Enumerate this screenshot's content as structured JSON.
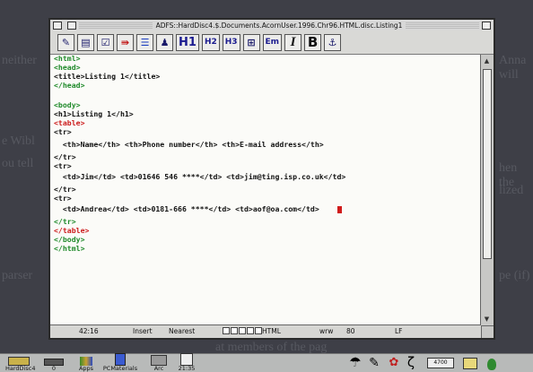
{
  "background_text": [
    "neither",
    "at members of the pag",
    "e will other HTML tags as for",
    "comments.",
    "e Wibl",
    "ou tell",
    "Anna will",
    "hen the",
    "lized",
    "Third, the parser is tion...",
    "parser",
    "pe (if)"
  ],
  "window": {
    "title": "ADFS::HardDisc4.$.Documents.AcornUser.1996.Chr96.HTML.disc.Listing1"
  },
  "toolbar": {
    "tools": [
      {
        "name": "pencil-icon",
        "label": "✎"
      },
      {
        "name": "list-icon",
        "label": "▤"
      },
      {
        "name": "check-icon",
        "label": "☑"
      },
      {
        "name": "arrow-right-icon",
        "label": "⇛"
      },
      {
        "name": "rule-icon",
        "label": "☰"
      },
      {
        "name": "image-icon",
        "label": "♟"
      },
      {
        "name": "h1-button",
        "label": "H1"
      },
      {
        "name": "h2-button",
        "label": "H2"
      },
      {
        "name": "h3-button",
        "label": "H3"
      },
      {
        "name": "blockquote-button",
        "label": "⊞"
      },
      {
        "name": "em-button",
        "label": "Em"
      },
      {
        "name": "italic-button",
        "label": "I"
      },
      {
        "name": "bold-button",
        "label": "B"
      },
      {
        "name": "anchor-icon",
        "label": "⚓"
      }
    ]
  },
  "editor": {
    "lines": [
      {
        "text": "<html>",
        "color": "green"
      },
      {
        "text": "<head>",
        "color": "green"
      },
      {
        "text": "<title>Listing 1</title>",
        "color": "black"
      },
      {
        "text": "</head>",
        "color": "green"
      },
      {
        "text": "",
        "color": "black"
      },
      {
        "text": "<body>",
        "color": "green"
      },
      {
        "text": "<h1>Listing 1</h1>",
        "color": "black"
      },
      {
        "text": "<table>",
        "color": "red"
      },
      {
        "text": "<tr>",
        "color": "black"
      },
      {
        "text": "  <th>Name</th> <th>Phone number</th> <th>E-mail address</th>",
        "color": "black"
      },
      {
        "text": "</tr>",
        "color": "black"
      },
      {
        "text": "<tr>",
        "color": "black"
      },
      {
        "text": "  <td>Jim</td> <td>01646 546 ****</td> <td>jim@ting.isp.co.uk</td>",
        "color": "black"
      },
      {
        "text": "</tr>",
        "color": "black"
      },
      {
        "text": "<tr>",
        "color": "black"
      },
      {
        "text": "  <td>Andrea</td> <td>0181-666 ****</td> <td>aof@oa.com</td>",
        "color": "black"
      },
      {
        "text": "</tr>",
        "color": "green"
      },
      {
        "text": "</table>",
        "color": "red"
      },
      {
        "text": "</body>",
        "color": "green"
      },
      {
        "text": "</html>",
        "color": "green"
      }
    ]
  },
  "statusbar": {
    "position": "42:16",
    "mode": "Insert",
    "match": "Nearest",
    "type": "HTML",
    "wrap": "wrw",
    "width": "80",
    "eol": "LF"
  },
  "iconbar": {
    "items": [
      {
        "name": "harddisc-icon",
        "label": "HardDisc4"
      },
      {
        "name": "floppy-icon",
        "label": "0"
      },
      {
        "name": "apps-icon",
        "label": "Apps"
      },
      {
        "name": "pcmaterials-icon",
        "label": "PCMaterials"
      },
      {
        "name": "arcfs-icon",
        "label": "Arc"
      },
      {
        "name": "clock-icon",
        "label": "21:35"
      },
      {
        "name": "tools-icon",
        "label": ""
      },
      {
        "name": "draw-icon",
        "label": ""
      },
      {
        "name": "palette-icon",
        "label": ""
      },
      {
        "name": "snake-icon",
        "label": ""
      },
      {
        "name": "memory-display",
        "label": "4700"
      },
      {
        "name": "display-icon",
        "label": ""
      },
      {
        "name": "acorn-icon",
        "label": ""
      }
    ]
  },
  "colors": {
    "green_tag": "#1f8a2a",
    "red_tag": "#cc1c1c",
    "text": "#121212",
    "desktop": "#3e3f47"
  }
}
